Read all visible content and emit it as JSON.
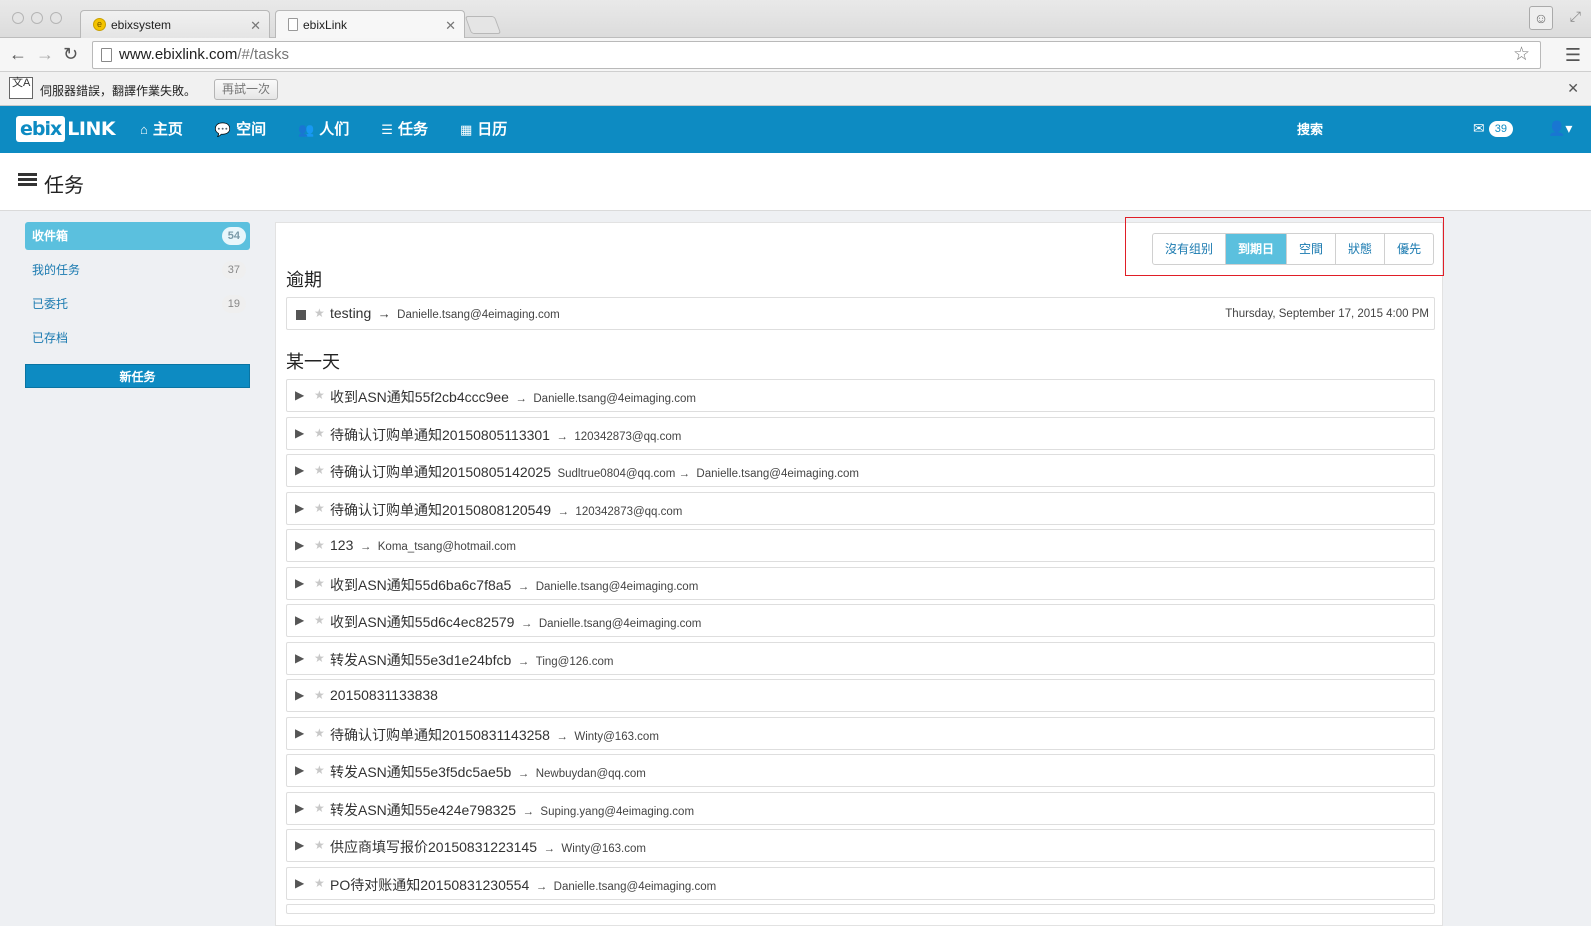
{
  "browser": {
    "tabs": [
      {
        "title": "ebixsystem",
        "favicon": "ebix-favicon-icon"
      },
      {
        "title": "ebixLink",
        "favicon": "document-icon"
      }
    ],
    "url_host": "www.ebixlink.com",
    "url_path": "/#/tasks"
  },
  "translate_bar": {
    "message": "伺服器錯誤，翻譯作業失敗。",
    "retry_label": "再試一次",
    "icon_text": "文A"
  },
  "app": {
    "logo_left": "ebix",
    "logo_right": "LINK",
    "nav": [
      {
        "label": "主页",
        "icon": "home-icon"
      },
      {
        "label": "空间",
        "icon": "comments-icon"
      },
      {
        "label": "人们",
        "icon": "users-icon"
      },
      {
        "label": "任务",
        "icon": "tasks-icon"
      },
      {
        "label": "日历",
        "icon": "calendar-icon"
      }
    ],
    "search_label": "搜索",
    "mail_count": "39"
  },
  "page": {
    "title": "任务"
  },
  "sidebar": {
    "items": [
      {
        "label": "收件箱",
        "count": "54"
      },
      {
        "label": "我的任务",
        "count": "37"
      },
      {
        "label": "已委托",
        "count": "19"
      },
      {
        "label": "已存档",
        "count": ""
      }
    ],
    "new_task_label": "新任务"
  },
  "grouping": {
    "buttons": [
      "沒有组别",
      "到期日",
      "空間",
      "狀態",
      "優先"
    ],
    "active": "到期日"
  },
  "sections": {
    "overdue_title": "逾期",
    "someday_title": "某一天"
  },
  "overdue_tasks": [
    {
      "name": "testing",
      "arrow": "→",
      "assignee": "Danielle.tsang@4eimaging.com",
      "due": "Thursday, September 17, 2015 4:00 PM"
    }
  ],
  "someday_tasks": [
    {
      "name": "收到ASN通知55f2cb4ccc9ee",
      "arrow": "→",
      "assignee": "Danielle.tsang@4eimaging.com"
    },
    {
      "name": "待确认订购单通知20150805113301",
      "arrow": "→",
      "assignee": "120342873@qq.com"
    },
    {
      "name": "待确认订购单通知20150805142025",
      "arrow": "Sudltrue0804@qq.com →",
      "assignee": "Danielle.tsang@4eimaging.com"
    },
    {
      "name": "待确认订购单通知20150808120549",
      "arrow": "→",
      "assignee": "120342873@qq.com"
    },
    {
      "name": "123",
      "arrow": "→",
      "assignee": "Koma_tsang@hotmail.com"
    },
    {
      "name": "收到ASN通知55d6ba6c7f8a5",
      "arrow": "→",
      "assignee": "Danielle.tsang@4eimaging.com"
    },
    {
      "name": "收到ASN通知55d6c4ec82579",
      "arrow": "→",
      "assignee": "Danielle.tsang@4eimaging.com"
    },
    {
      "name": "转发ASN通知55e3d1e24bfcb",
      "arrow": "→",
      "assignee": "Ting@126.com"
    },
    {
      "name": "20150831133838",
      "arrow": "",
      "assignee": ""
    },
    {
      "name": "待确认订购单通知20150831143258",
      "arrow": "→",
      "assignee": "Winty@163.com"
    },
    {
      "name": "转发ASN通知55e3f5dc5ae5b",
      "arrow": "→",
      "assignee": "Newbuydan@qq.com"
    },
    {
      "name": "转发ASN通知55e424e798325",
      "arrow": "→",
      "assignee": "Suping.yang@4eimaging.com"
    },
    {
      "name": "供应商填写报价20150831223145",
      "arrow": "→",
      "assignee": "Winty@163.com"
    },
    {
      "name": "PO待对账通知20150831230554",
      "arrow": "→",
      "assignee": "Danielle.tsang@4eimaging.com"
    }
  ],
  "colors": {
    "navbar": "#0d8bc2",
    "active_pill": "#5bc0de",
    "highlight_border": "#e01e27"
  }
}
